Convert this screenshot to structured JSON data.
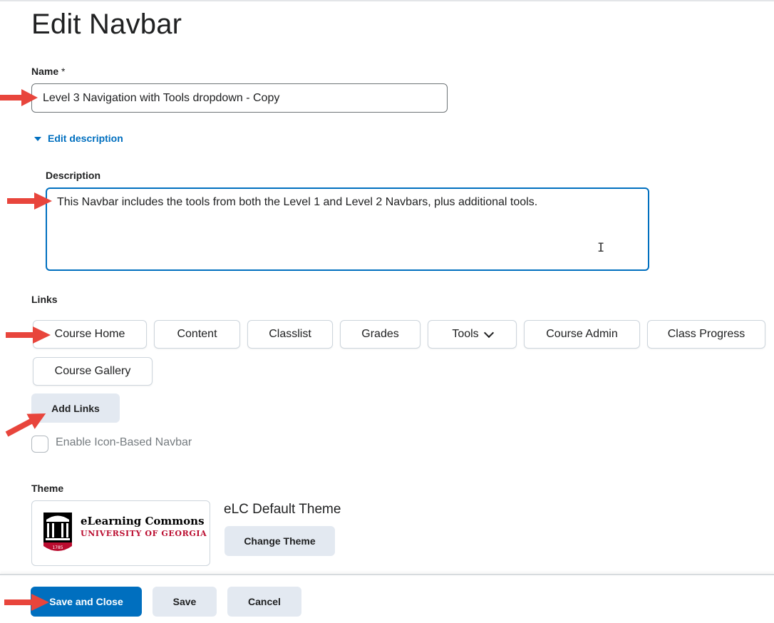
{
  "page": {
    "title": "Edit Navbar"
  },
  "name_field": {
    "label": "Name",
    "required_mark": "*",
    "value": "Level 3 Navigation with Tools dropdown - Copy"
  },
  "description_toggle": {
    "label": "Edit description"
  },
  "description_field": {
    "label": "Description",
    "value": "This Navbar includes the tools from both the Level 1 and Level 2 Navbars, plus additional tools."
  },
  "links": {
    "label": "Links",
    "items": [
      {
        "label": "Course Home"
      },
      {
        "label": "Content"
      },
      {
        "label": "Classlist"
      },
      {
        "label": "Grades"
      },
      {
        "label": "Tools"
      },
      {
        "label": "Course Admin"
      },
      {
        "label": "Class Progress"
      },
      {
        "label": "Course Gallery"
      }
    ],
    "add_button": "Add Links"
  },
  "icon_navbar": {
    "label": "Enable Icon-Based Navbar",
    "checked": false
  },
  "theme": {
    "label": "Theme",
    "name": "eLC Default Theme",
    "change_button": "Change Theme",
    "logo_title": "eLearning Commons",
    "logo_subtitle": "UNIVERSITY OF GEORGIA",
    "logo_year": "1785"
  },
  "footer": {
    "save_close": "Save and Close",
    "save": "Save",
    "cancel": "Cancel"
  },
  "colors": {
    "primary": "#006fbf",
    "secondary_button": "#e3e9f1",
    "annotation_arrow": "#e8453c",
    "uga_red": "#ba0c2f"
  }
}
